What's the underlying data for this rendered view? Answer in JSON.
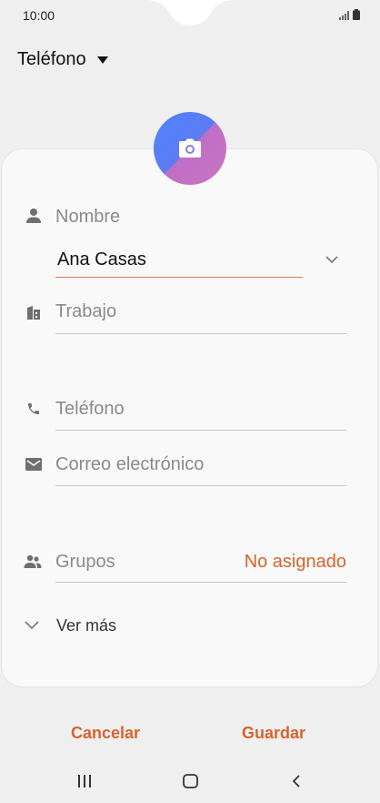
{
  "status_bar": {
    "time": "10:00"
  },
  "header": {
    "account_type": "Teléfono"
  },
  "form": {
    "name_label": "Nombre",
    "name_value": "Ana Casas",
    "work_placeholder": "Trabajo",
    "phone_placeholder": "Teléfono",
    "email_placeholder": "Correo electrónico",
    "groups_label": "Grupos",
    "groups_value": "No asignado",
    "more_label": "Ver más"
  },
  "actions": {
    "cancel_label": "Cancelar",
    "save_label": "Guardar"
  },
  "colors": {
    "accent": "#d9632b",
    "background": "#efefef",
    "card": "#f9f9f9"
  }
}
